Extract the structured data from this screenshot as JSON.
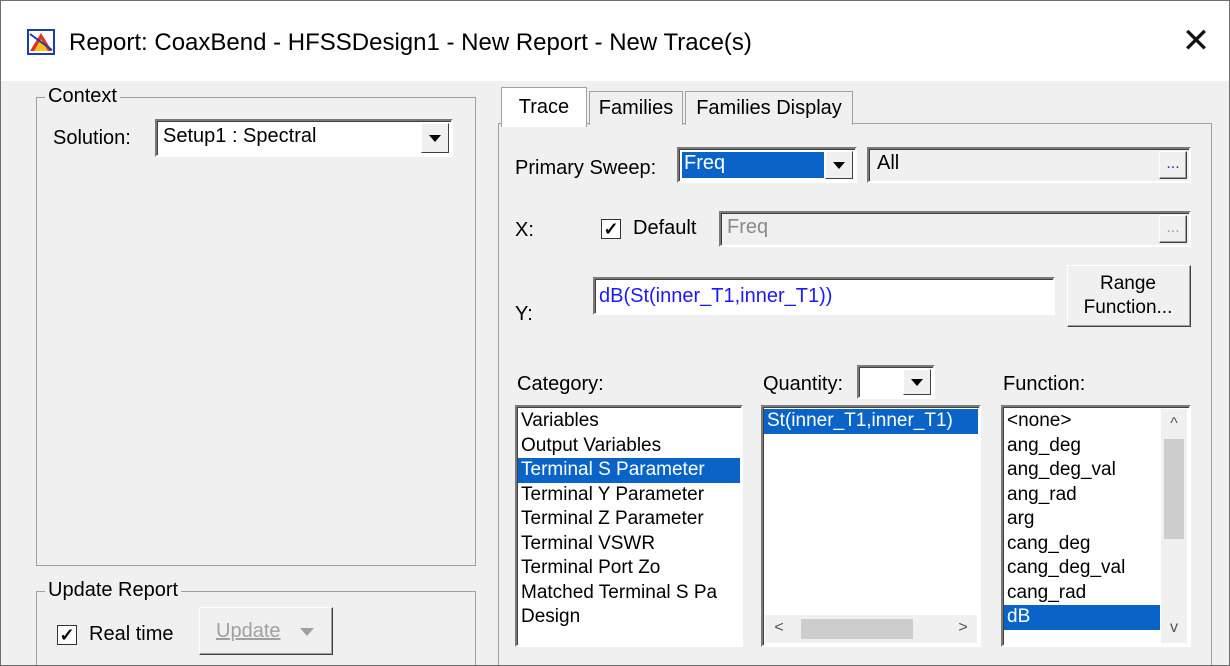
{
  "window": {
    "title": "Report: CoaxBend - HFSSDesign1 - New Report - New Trace(s)"
  },
  "context": {
    "group_label": "Context",
    "solution_label": "Solution:",
    "solution_value": "Setup1 : Spectral"
  },
  "update_report": {
    "group_label": "Update Report",
    "realtime_label": "Real time",
    "realtime_checked": true,
    "update_label": "Update"
  },
  "tabs": [
    {
      "label": "Trace",
      "active": true
    },
    {
      "label": "Families",
      "active": false
    },
    {
      "label": "Families Display",
      "active": false
    }
  ],
  "trace": {
    "primary_sweep_label": "Primary Sweep:",
    "primary_sweep_value": "Freq",
    "sweep_range_value": "All",
    "ellipsis": "...",
    "x_label": "X:",
    "default_label": "Default",
    "default_checked": true,
    "x_value": "Freq",
    "y_label": "Y:",
    "y_value": "dB(St(inner_T1,inner_T1))",
    "range_function_line1": "Range",
    "range_function_line2": "Function...",
    "category_label": "Category:",
    "quantity_label": "Quantity:",
    "quantity_value": "",
    "function_label": "Function:"
  },
  "category_items": [
    "Variables",
    "Output Variables",
    "Terminal S Parameter",
    "Terminal Y Parameter",
    "Terminal Z Parameter",
    "Terminal VSWR",
    "Terminal Port Zo",
    "Matched Terminal S Pa",
    "Design"
  ],
  "category_selected": "Terminal S Parameter",
  "quantity_items": [
    "St(inner_T1,inner_T1)"
  ],
  "function_items": [
    "<none>",
    "ang_deg",
    "ang_deg_val",
    "ang_rad",
    "arg",
    "cang_deg",
    "cang_deg_val",
    "cang_rad",
    "dB"
  ],
  "function_selected": "dB",
  "colors": {
    "selection": "#0a64c8",
    "y_text": "#1a1aff"
  }
}
